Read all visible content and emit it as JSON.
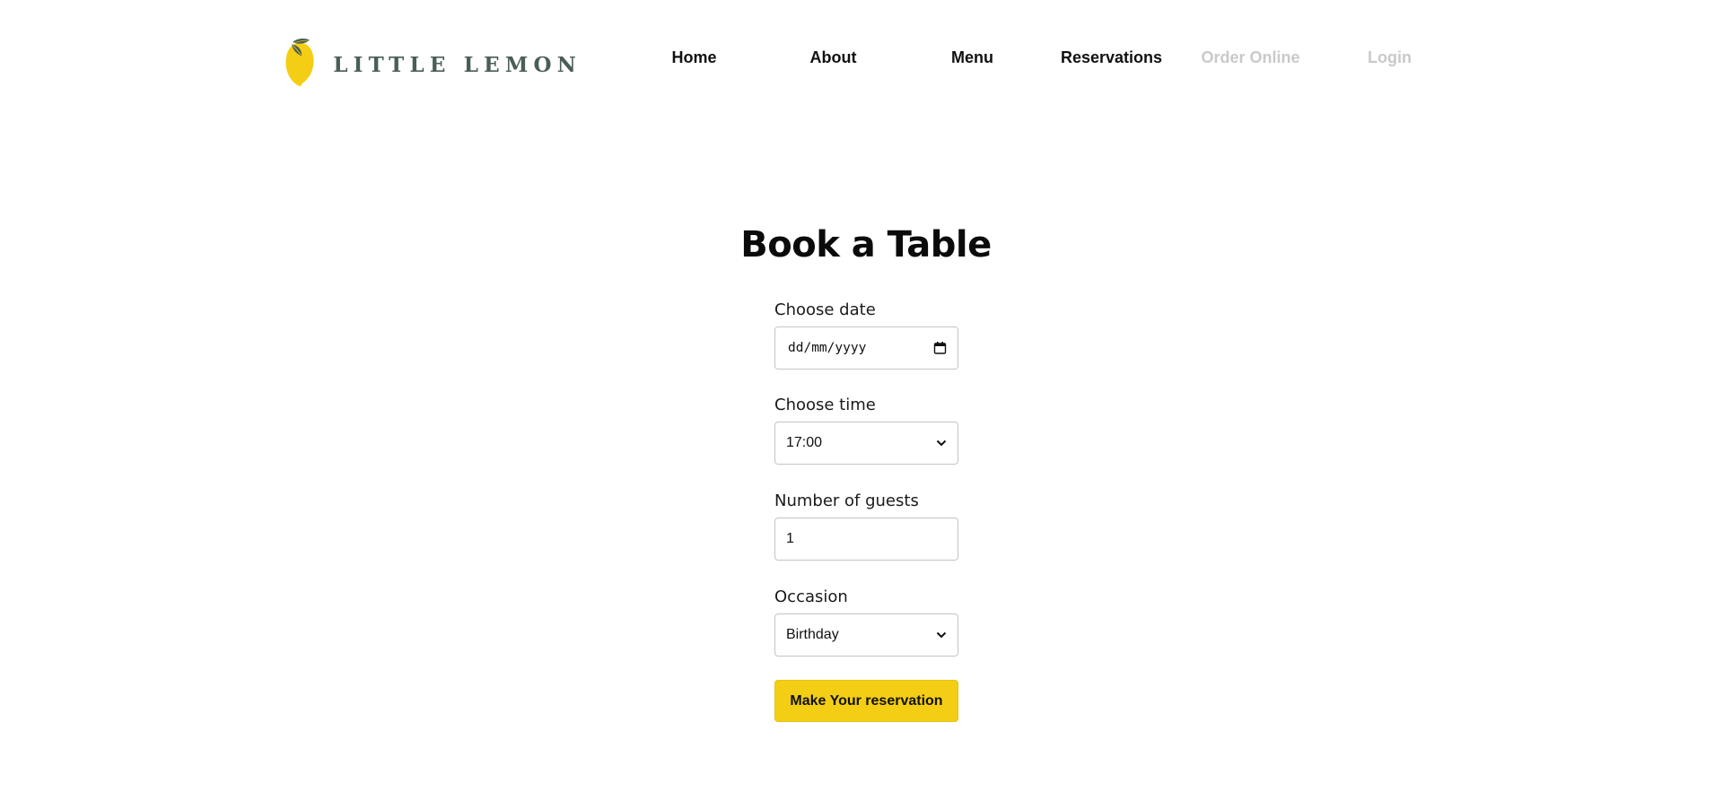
{
  "brand": {
    "name": "LITTLE LEMON",
    "colors": {
      "lemon": "#f4ce14",
      "leaf": "#495e57",
      "text": "#495e57"
    }
  },
  "nav": {
    "items": [
      {
        "label": "Home",
        "enabled": true
      },
      {
        "label": "About",
        "enabled": true
      },
      {
        "label": "Menu",
        "enabled": true
      },
      {
        "label": "Reservations",
        "enabled": true
      },
      {
        "label": "Order Online",
        "enabled": false
      },
      {
        "label": "Login",
        "enabled": false
      }
    ]
  },
  "booking": {
    "title": "Book a Table",
    "date": {
      "label": "Choose date",
      "value": "dd/mm/yyyy",
      "icon": "calendar-icon"
    },
    "time": {
      "label": "Choose time",
      "value": "17:00",
      "icon": "chevron-down-icon"
    },
    "guests": {
      "label": "Number of guests",
      "value": "1"
    },
    "occasion": {
      "label": "Occasion",
      "value": "Birthday",
      "icon": "chevron-down-icon"
    },
    "submit_label": "Make Your reservation",
    "colors": {
      "button": "#f4ce14",
      "border": "#c4c4c4"
    }
  }
}
